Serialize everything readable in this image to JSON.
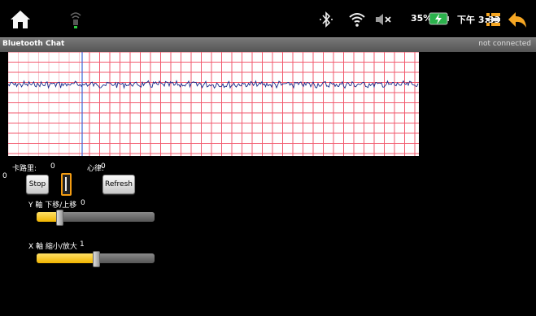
{
  "status_bar": {
    "battery_percent": "35%",
    "time": "下午 3:33",
    "icons": [
      "home-icon",
      "usb-debug-icon",
      "bluetooth-icon",
      "wifi-icon",
      "volume-muted-icon",
      "battery-charging-icon",
      "menu-icon",
      "back-icon"
    ]
  },
  "title_bar": {
    "app_title": "Bluetooth Chat",
    "connection_status": "not connected"
  },
  "ecg": {
    "grid_color": "#f25a6e",
    "trace_color": "#1a2d8c",
    "cursor_color": "#3a63d8"
  },
  "readouts": {
    "calories_label": "卡路里:",
    "calories_value": "0",
    "heart_rate_label": "心律:",
    "heart_rate_value": "0",
    "counter_value": "0"
  },
  "buttons": {
    "stop": "Stop",
    "refresh": "Refresh"
  },
  "sliders": {
    "y_axis": {
      "label": "Y 軸 下移/上移",
      "value": "0",
      "level": 0.19
    },
    "x_axis": {
      "label": "X 軸 縮小/放大",
      "value": "1",
      "level": 0.5
    }
  },
  "colors": {
    "accent": "#f0b400",
    "background": "#000000"
  }
}
